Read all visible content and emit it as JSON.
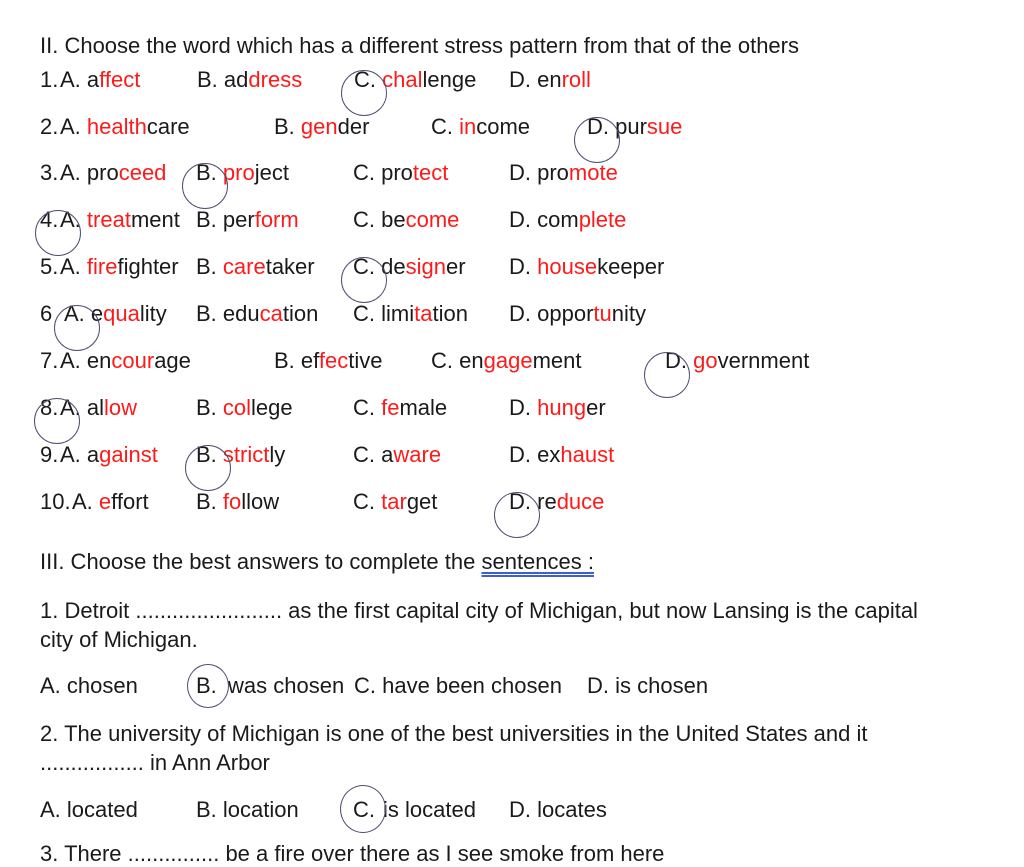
{
  "section2": {
    "title": "II. Choose the word which has a different stress pattern from that of the others",
    "rows": [
      {
        "num": "1.",
        "options": [
          {
            "letter": "A.",
            "pre": "a",
            "stress": "ffect",
            "post": ""
          },
          {
            "letter": "B.",
            "pre": "ad",
            "stress": "dress",
            "post": ""
          },
          {
            "letter": "C.",
            "pre": "",
            "stress": "chal",
            "post": "lenge"
          },
          {
            "letter": "D.",
            "pre": "en",
            "stress": "roll",
            "post": ""
          }
        ],
        "answer": "C"
      },
      {
        "num": "2.",
        "options": [
          {
            "letter": "A.",
            "pre": "",
            "stress": "health",
            "post": "care"
          },
          {
            "letter": "B.",
            "pre": "",
            "stress": "gen",
            "post": "der"
          },
          {
            "letter": "C.",
            "pre": "",
            "stress": "in",
            "post": "come"
          },
          {
            "letter": "D.",
            "pre": "pur",
            "stress": "sue",
            "post": ""
          }
        ],
        "answer": "D"
      },
      {
        "num": "3.",
        "options": [
          {
            "letter": "A.",
            "pre": "pro",
            "stress": "ceed",
            "post": ""
          },
          {
            "letter": "B.",
            "pre": "",
            "stress": "pro",
            "post": "ject"
          },
          {
            "letter": "C.",
            "pre": "pro",
            "stress": "tect",
            "post": ""
          },
          {
            "letter": "D.",
            "pre": "pro",
            "stress": "mote",
            "post": ""
          }
        ],
        "answer": "B"
      },
      {
        "num": "4.",
        "options": [
          {
            "letter": "A.",
            "pre": "",
            "stress": "treat",
            "post": "ment"
          },
          {
            "letter": "B.",
            "pre": "per",
            "stress": "form",
            "post": ""
          },
          {
            "letter": "C.",
            "pre": "be",
            "stress": "come",
            "post": ""
          },
          {
            "letter": "D.",
            "pre": "com",
            "stress": "plete",
            "post": ""
          }
        ],
        "answer": "A"
      },
      {
        "num": "5.",
        "options": [
          {
            "letter": "A.",
            "pre": "",
            "stress": "fire",
            "post": "fighter"
          },
          {
            "letter": "B.",
            "pre": "",
            "stress": "care",
            "post": "taker"
          },
          {
            "letter": "C.",
            "pre": "de",
            "stress": "sign",
            "post": "er"
          },
          {
            "letter": "D.",
            "pre": "",
            "stress": "house",
            "post": "keeper"
          }
        ],
        "answer": "C"
      },
      {
        "num": "6",
        "options": [
          {
            "letter": "A.",
            "pre": "e",
            "stress": "qua",
            "post": "lity"
          },
          {
            "letter": "B.",
            "pre": "edu",
            "stress": "ca",
            "post": "tion"
          },
          {
            "letter": "C.",
            "pre": "limi",
            "stress": "ta",
            "post": "tion"
          },
          {
            "letter": "D.",
            "pre": "oppor",
            "stress": "tu",
            "post": "nity"
          }
        ],
        "answer": "A"
      },
      {
        "num": "7.",
        "options": [
          {
            "letter": "A.",
            "pre": "en",
            "stress": "cour",
            "post": "age"
          },
          {
            "letter": "B.",
            "pre": "ef",
            "stress": "fec",
            "post": "tive"
          },
          {
            "letter": "C.",
            "pre": "en",
            "stress": "gage",
            "post": "ment"
          },
          {
            "letter": "D.",
            "pre": "",
            "stress": "go",
            "post": "vernment"
          }
        ],
        "answer": "D"
      },
      {
        "num": "8.",
        "options": [
          {
            "letter": "A.",
            "pre": "al",
            "stress": "low",
            "post": ""
          },
          {
            "letter": "B.",
            "pre": "",
            "stress": "col",
            "post": "lege"
          },
          {
            "letter": "C.",
            "pre": "",
            "stress": "fe",
            "post": "male"
          },
          {
            "letter": "D.",
            "pre": "",
            "stress": "hung",
            "post": "er"
          }
        ],
        "answer": "A"
      },
      {
        "num": "9.",
        "options": [
          {
            "letter": "A.",
            "pre": "a",
            "stress": "gainst",
            "post": ""
          },
          {
            "letter": "B.",
            "pre": "",
            "stress": "strict",
            "post": "ly"
          },
          {
            "letter": "C.",
            "pre": "a",
            "stress": "ware",
            "post": ""
          },
          {
            "letter": "D.",
            "pre": "ex",
            "stress": "haust",
            "post": ""
          }
        ],
        "answer": "B"
      },
      {
        "num": "10.",
        "options": [
          {
            "letter": "A.",
            "pre": "",
            "stress": "e",
            "post": "ffort"
          },
          {
            "letter": "B.",
            "pre": "",
            "stress": "fo",
            "post": "llow"
          },
          {
            "letter": "C.",
            "pre": "",
            "stress": "tar",
            "post": "get"
          },
          {
            "letter": "D.",
            "pre": "re",
            "stress": "duce",
            "post": ""
          }
        ],
        "answer": "D"
      }
    ]
  },
  "section3": {
    "title_pre": "III. Choose the best answers to complete the ",
    "title_flagged": "sentences :",
    "questions": [
      {
        "text_line1": "1. Detroit ........................ as the first capital city of Michigan, but now Lansing is the capital",
        "text_line2": "city of Michigan.",
        "options": [
          "A. chosen",
          "B.",
          "was chosen",
          "C. have been chosen",
          "D. is chosen"
        ],
        "answer": "B"
      },
      {
        "text_line1": "2. The university of Michigan is one of the best universities in the United States and it",
        "text_line2": "................. in Ann Arbor",
        "options": [
          "A. located",
          "B. location",
          "C.",
          "is located",
          "D. locates"
        ],
        "answer": "C"
      },
      {
        "text_line1": "3. There ............... be a fire over there as I see smoke from here"
      }
    ]
  },
  "colors": {
    "stress": "#ff1a1a",
    "text": "#1a1a1a",
    "circle": "#4b5070",
    "grammar_underline": "#3d5fd0"
  }
}
